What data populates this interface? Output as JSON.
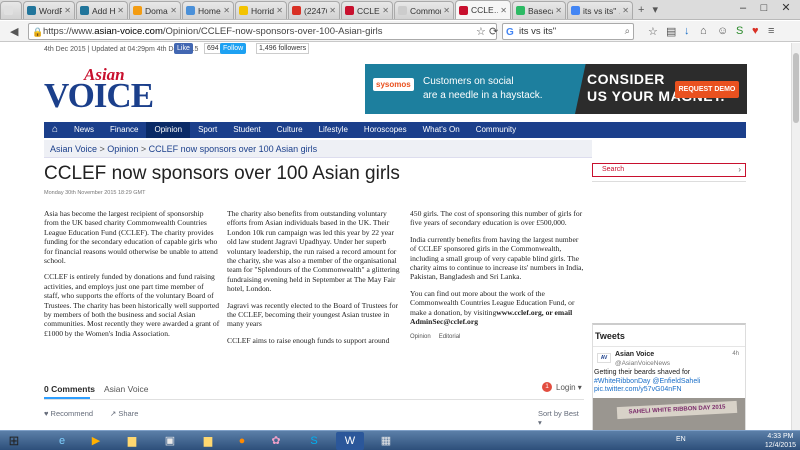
{
  "browser": {
    "tabs": [
      {
        "label": "",
        "color": "#e0e0e0"
      },
      {
        "label": "WordPres…",
        "color": "#21759b"
      },
      {
        "label": "Add HT…",
        "color": "#21759b"
      },
      {
        "label": "Domain …",
        "color": "#f39c12"
      },
      {
        "label": "Home",
        "color": "#4a90d9"
      },
      {
        "label": "Horrid H…",
        "color": "#f3c300"
      },
      {
        "label": "(22476 un…",
        "color": "#d93025"
      },
      {
        "label": "CCLEF -…",
        "color": "#c8102e"
      },
      {
        "label": "Commonwea…",
        "color": "#cccccc"
      },
      {
        "label": "CCLE…",
        "color": "#c8102e",
        "active": true
      },
      {
        "label": "Basecam…",
        "color": "#2cba64"
      },
      {
        "label": "its vs its\" …",
        "color": "#4285f4"
      }
    ],
    "url_prefix": "https://www.",
    "url_domain": "asian-voice.com",
    "url_path": "/Opinion/CCLEF-now-sponsors-over-100-Asian-girls",
    "search_value": "its vs its\""
  },
  "site": {
    "date_line": "4th Dec 2015 | Updated at 04:29pm 4th Dec 2015",
    "fb_like": "Like",
    "fb_count": "694",
    "tw_follow": "Follow",
    "tw_count": "1,496 followers",
    "logo_top": "Asian",
    "logo_bottom": "VOICE",
    "ad": {
      "brand": "sysomos",
      "line1": "Customers on social",
      "line2": "are a needle in a haystack.",
      "big1": "CONSIDER",
      "big2": "US YOUR MAGNET.",
      "cta": "REQUEST DEMO"
    },
    "menu": [
      "News",
      "Finance",
      "Opinion",
      "Sport",
      "Student",
      "Culture",
      "Lifestyle",
      "Horoscopes",
      "What's On",
      "Community"
    ],
    "menu_active": "Opinion",
    "breadcrumb": [
      "Asian Voice",
      "Opinion",
      "CCLEF now sponsors over 100 Asian girls"
    ]
  },
  "article": {
    "title": "CCLEF now sponsors over 100 Asian girls",
    "date": "Monday 30th November 2015 18:29 GMT",
    "col1": [
      "Asia has become the largest recipient of sponsorship from the UK based charity Commonwealth Countries League Education Fund (CCLEF). The charity provides funding for the secondary education of capable girls who for financial reasons would otherwise be unable to attend school.",
      "CCLEF is entirely funded by donations and fund raising activities, and employs just one part time member of staff, who supports the efforts of the voluntary Board of Trustees. The charity has been historically well supported by members of both the business and social Asian communities. Most recently they were awarded a grant of £1000 by the Women's India Association."
    ],
    "col2": [
      "The charity also benefits from outstanding voluntary efforts from Asian individuals based in the UK. Their London 10k run campaign was led this year by 22 year old law student Jagravi Upadhyay. Under her superb voluntary leadership, the run raised a record amount for the charity, she was also a member of the organisational team for \"Splendours of the Commonwealth\" a glittering fundraising evening held in September at The May Fair hotel, London.",
      "Jagravi was recently elected to the Board of Trustees for the CCLEF, becoming their youngest Asian trustee in many years",
      "CCLEF aims to raise enough funds to support around"
    ],
    "col3": [
      "450 girls. The cost of sponsoring this number of girls for five years of secondary education is over £500,000.",
      "India currently benefits from having the largest number of CCLEF sponsored girls in the Commonwealth, including a small group of very capable blind girls. The charity aims to continue to increase its' numbers in India, Pakistan, Bangladesh and Sri Lanka."
    ],
    "col3_last_plain": "You can find out more about the work of the Commonwealth Countries League Education Fund, or make a donation, by visiting",
    "col3_last_bold": "www.cclef.org, or email AdminSec@cclef.org",
    "tags": [
      "Opinion",
      "Editorial"
    ]
  },
  "sidebar": {
    "search_placeholder": "Search",
    "tweets_header": "Tweets",
    "tweet_name": "Asian Voice",
    "tweet_handle": "@AsianVoiceNews",
    "tweet_time": "4h",
    "tweet_text_1": "Getting their beards shaved for",
    "tweet_link_1": "#WhiteRibbonDay @EnfieldSaheli",
    "tweet_link_2": "pic.twitter.com/y57vG04nFN",
    "tweet_avatar": "AV",
    "tweet_image_text": "SAHELI WHITE RIBBON DAY 2015"
  },
  "comments": {
    "count_label": "0 Comments",
    "site_label": "Asian Voice",
    "badge": "1",
    "login": "Login",
    "recommend": "Recommend",
    "share": "Share",
    "sort": "Sort by Best"
  },
  "taskbar": {
    "lang": "EN",
    "time": "4:33 PM",
    "date": "12/4/2015"
  }
}
